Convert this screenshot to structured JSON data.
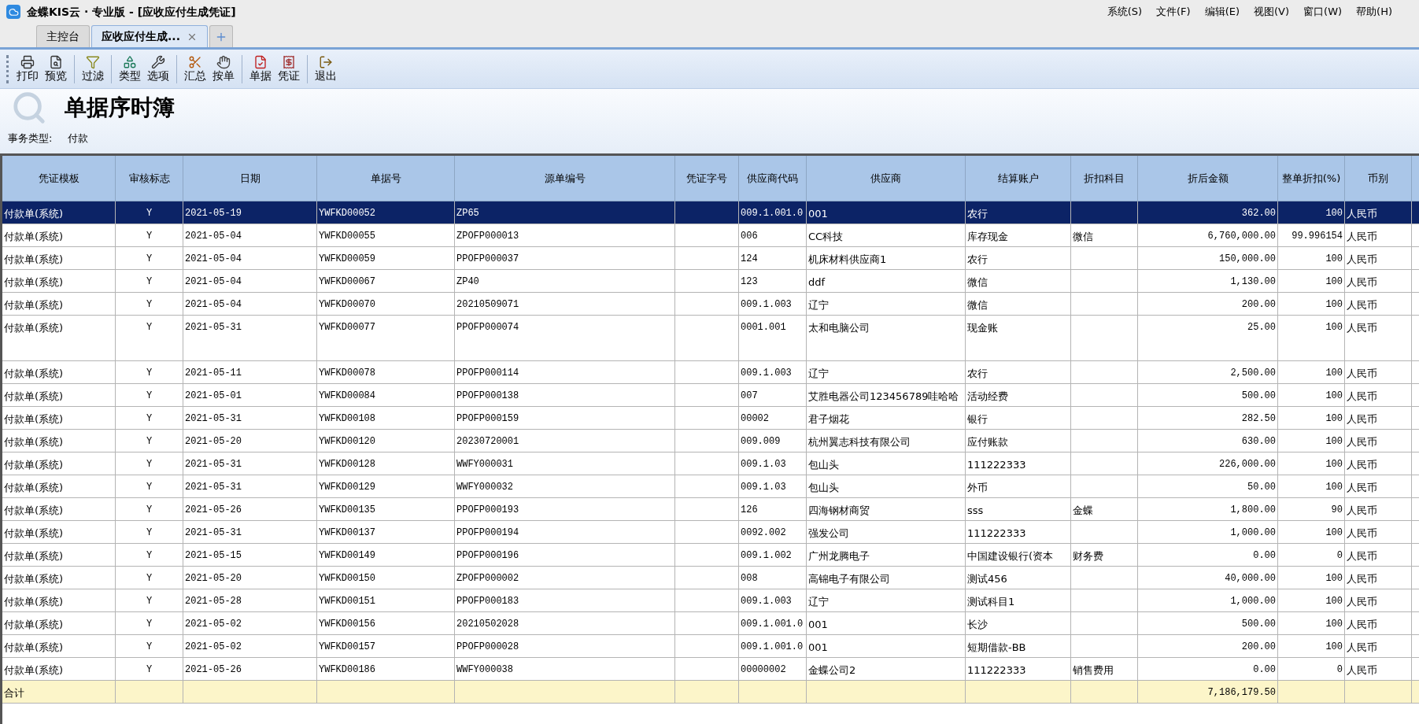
{
  "window": {
    "title": "金蝶KIS云 · 专业版 - [应收应付生成凭证]"
  },
  "menu": [
    "系统(S)",
    "文件(F)",
    "编辑(E)",
    "视图(V)",
    "窗口(W)",
    "帮助(H)"
  ],
  "tabs": [
    {
      "label": "主控台",
      "selected": false
    },
    {
      "label": "应收应付生成...",
      "selected": true
    }
  ],
  "toolbar": [
    [
      "打印",
      "预览"
    ],
    [
      "过滤"
    ],
    [
      "类型",
      "选项"
    ],
    [
      "汇总",
      "按单"
    ],
    [
      "单据",
      "凭证"
    ],
    [
      "退出"
    ]
  ],
  "page_title": "单据序时簿",
  "filter": {
    "label": "事务类型:",
    "value": "付款"
  },
  "table": {
    "columns": [
      "凭证模板",
      "审核标志",
      "日期",
      "单据号",
      "源单编号",
      "凭证字号",
      "供应商代码",
      "供应商",
      "结算账户",
      "折扣科目",
      "折后金额",
      "整单折扣(%)",
      "币别"
    ],
    "rows": [
      {
        "selected": true,
        "kind": "single",
        "cells": [
          "付款单(系统)",
          "Y",
          "2021-05-19",
          "YWFKD00052",
          "ZP65",
          "",
          "009.1.001.0",
          "001",
          "农行",
          "",
          "362.00",
          "100",
          "人民币"
        ]
      },
      {
        "selected": false,
        "kind": "single",
        "cells": [
          "付款单(系统)",
          "Y",
          "2021-05-04",
          "YWFKD00055",
          "ZPOFP000013",
          "",
          "006",
          "CC科技",
          "库存现金",
          "微信",
          "6,760,000.00",
          "99.996154",
          "人民币"
        ]
      },
      {
        "selected": false,
        "kind": "single",
        "cells": [
          "付款单(系统)",
          "Y",
          "2021-05-04",
          "YWFKD00059",
          "PPOFP000037",
          "",
          "124",
          "机床材料供应商1",
          "农行",
          "",
          "150,000.00",
          "100",
          "人民币"
        ]
      },
      {
        "selected": false,
        "kind": "single",
        "cells": [
          "付款单(系统)",
          "Y",
          "2021-05-04",
          "YWFKD00067",
          "ZP40",
          "",
          "123",
          "ddf",
          "微信",
          "",
          "1,130.00",
          "100",
          "人民币"
        ]
      },
      {
        "selected": false,
        "kind": "single",
        "cells": [
          "付款单(系统)",
          "Y",
          "2021-05-04",
          "YWFKD00070",
          "20210509071",
          "",
          "009.1.003",
          "辽宁",
          "微信",
          "",
          "200.00",
          "100",
          "人民币"
        ]
      },
      {
        "selected": false,
        "kind": "double",
        "cells": [
          "付款单(系统)",
          "Y",
          "2021-05-31",
          "YWFKD00077",
          "PPOFP000074",
          "",
          "0001.001",
          "太和电脑公司",
          "现金账",
          "",
          "25.00",
          "100",
          "人民币"
        ]
      },
      {
        "selected": false,
        "kind": "single",
        "cells": [
          "付款单(系统)",
          "Y",
          "2021-05-11",
          "YWFKD00078",
          "PPOFP000114",
          "",
          "009.1.003",
          "辽宁",
          "农行",
          "",
          "2,500.00",
          "100",
          "人民币"
        ]
      },
      {
        "selected": false,
        "kind": "single",
        "cells": [
          "付款单(系统)",
          "Y",
          "2021-05-01",
          "YWFKD00084",
          "PPOFP000138",
          "",
          "007",
          "艾胜电器公司123456789哇哈哈",
          "活动经费",
          "",
          "500.00",
          "100",
          "人民币"
        ]
      },
      {
        "selected": false,
        "kind": "single",
        "cells": [
          "付款单(系统)",
          "Y",
          "2021-05-31",
          "YWFKD00108",
          "PPOFP000159",
          "",
          "00002",
          "君子烟花",
          "银行",
          "",
          "282.50",
          "100",
          "人民币"
        ]
      },
      {
        "selected": false,
        "kind": "single",
        "cells": [
          "付款单(系统)",
          "Y",
          "2021-05-20",
          "YWFKD00120",
          "20230720001",
          "",
          "009.009",
          "杭州翼志科技有限公司",
          "应付账款",
          "",
          "630.00",
          "100",
          "人民币"
        ]
      },
      {
        "selected": false,
        "kind": "single",
        "cells": [
          "付款单(系统)",
          "Y",
          "2021-05-31",
          "YWFKD00128",
          "WWFY000031",
          "",
          "009.1.03",
          "包山头",
          "111222333",
          "",
          "226,000.00",
          "100",
          "人民币"
        ]
      },
      {
        "selected": false,
        "kind": "single",
        "cells": [
          "付款单(系统)",
          "Y",
          "2021-05-31",
          "YWFKD00129",
          "WWFY000032",
          "",
          "009.1.03",
          "包山头",
          "外币",
          "",
          "50.00",
          "100",
          "人民币"
        ]
      },
      {
        "selected": false,
        "kind": "single",
        "cells": [
          "付款单(系统)",
          "Y",
          "2021-05-26",
          "YWFKD00135",
          "PPOFP000193",
          "",
          "126",
          "四海钢材商贸",
          "sss",
          "金蝶",
          "1,800.00",
          "90",
          "人民币"
        ]
      },
      {
        "selected": false,
        "kind": "single",
        "cells": [
          "付款单(系统)",
          "Y",
          "2021-05-31",
          "YWFKD00137",
          "PPOFP000194",
          "",
          "0092.002",
          "强发公司",
          "111222333",
          "",
          "1,000.00",
          "100",
          "人民币"
        ]
      },
      {
        "selected": false,
        "kind": "single",
        "cells": [
          "付款单(系统)",
          "Y",
          "2021-05-15",
          "YWFKD00149",
          "PPOFP000196",
          "",
          "009.1.002",
          "广州龙腾电子",
          "中国建设银行(资本",
          "财务费",
          "0.00",
          "0",
          "人民币"
        ]
      },
      {
        "selected": false,
        "kind": "single",
        "cells": [
          "付款单(系统)",
          "Y",
          "2021-05-20",
          "YWFKD00150",
          "ZPOFP000002",
          "",
          "008",
          "高锦电子有限公司",
          "测试456",
          "",
          "40,000.00",
          "100",
          "人民币"
        ]
      },
      {
        "selected": false,
        "kind": "single",
        "cells": [
          "付款单(系统)",
          "Y",
          "2021-05-28",
          "YWFKD00151",
          "PPOFP000183",
          "",
          "009.1.003",
          "辽宁",
          "测试科目1",
          "",
          "1,000.00",
          "100",
          "人民币"
        ]
      },
      {
        "selected": false,
        "kind": "single",
        "cells": [
          "付款单(系统)",
          "Y",
          "2021-05-02",
          "YWFKD00156",
          "20210502028",
          "",
          "009.1.001.0",
          "001",
          "长沙",
          "",
          "500.00",
          "100",
          "人民币"
        ]
      },
      {
        "selected": false,
        "kind": "single",
        "cells": [
          "付款单(系统)",
          "Y",
          "2021-05-02",
          "YWFKD00157",
          "PPOFP000028",
          "",
          "009.1.001.0",
          "001",
          "短期借款-BB",
          "",
          "200.00",
          "100",
          "人民币"
        ]
      },
      {
        "selected": false,
        "kind": "single",
        "cells": [
          "付款单(系统)",
          "Y",
          "2021-05-26",
          "YWFKD00186",
          "WWFY000038",
          "",
          "00000002",
          "金蝶公司2",
          "111222333",
          "销售费用",
          "0.00",
          "0",
          "人民币"
        ]
      }
    ],
    "total": {
      "label": "合计",
      "amount": "7,186,179.50"
    }
  }
}
